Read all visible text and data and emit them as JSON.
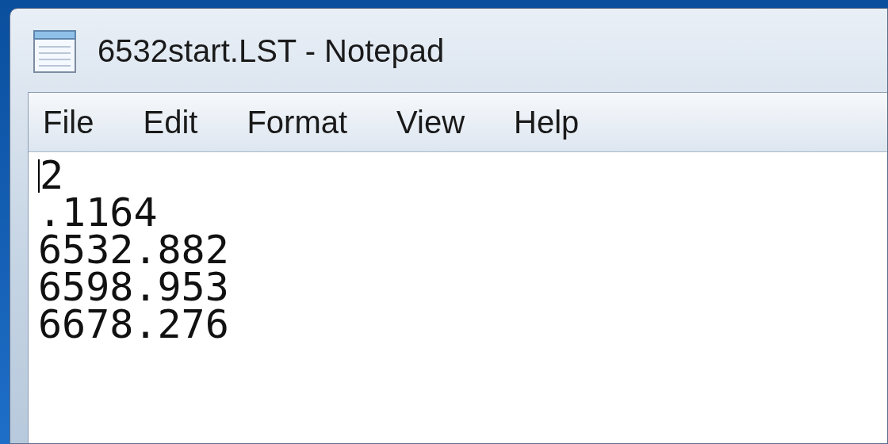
{
  "window": {
    "title": "6532start.LST - Notepad"
  },
  "menu": [
    "File",
    "Edit",
    "Format",
    "View",
    "Help"
  ],
  "content": {
    "lines": [
      "2",
      ".1164",
      "6532.882",
      "6598.953",
      "6678.276"
    ]
  }
}
